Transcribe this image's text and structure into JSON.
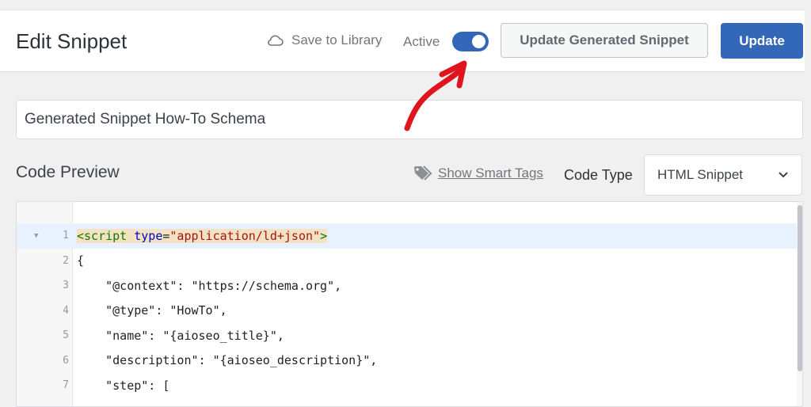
{
  "header": {
    "title": "Edit Snippet",
    "save_to_library": "Save to Library",
    "active_label": "Active",
    "active": true,
    "update_generated_label": "Update Generated Snippet",
    "update_label": "Update"
  },
  "snippet": {
    "title_value": "Generated Snippet How-To Schema"
  },
  "code_preview": {
    "heading": "Code Preview",
    "smart_tags_link": "Show Smart Tags",
    "code_type_label": "Code Type",
    "code_type_value": "HTML Snippet"
  },
  "code_lines": [
    {
      "n": "1",
      "text": "<script type=\"application/ld+json\">"
    },
    {
      "n": "2",
      "text": "{"
    },
    {
      "n": "3",
      "text": "    \"@context\": \"https://schema.org\","
    },
    {
      "n": "4",
      "text": "    \"@type\": \"HowTo\","
    },
    {
      "n": "5",
      "text": "    \"name\": \"{aioseo_title}\","
    },
    {
      "n": "6",
      "text": "    \"description\": \"{aioseo_description}\","
    },
    {
      "n": "7",
      "text": "    \"step\": ["
    }
  ],
  "colors": {
    "accent": "#3368b9",
    "annotation_arrow": "#e0141e"
  }
}
